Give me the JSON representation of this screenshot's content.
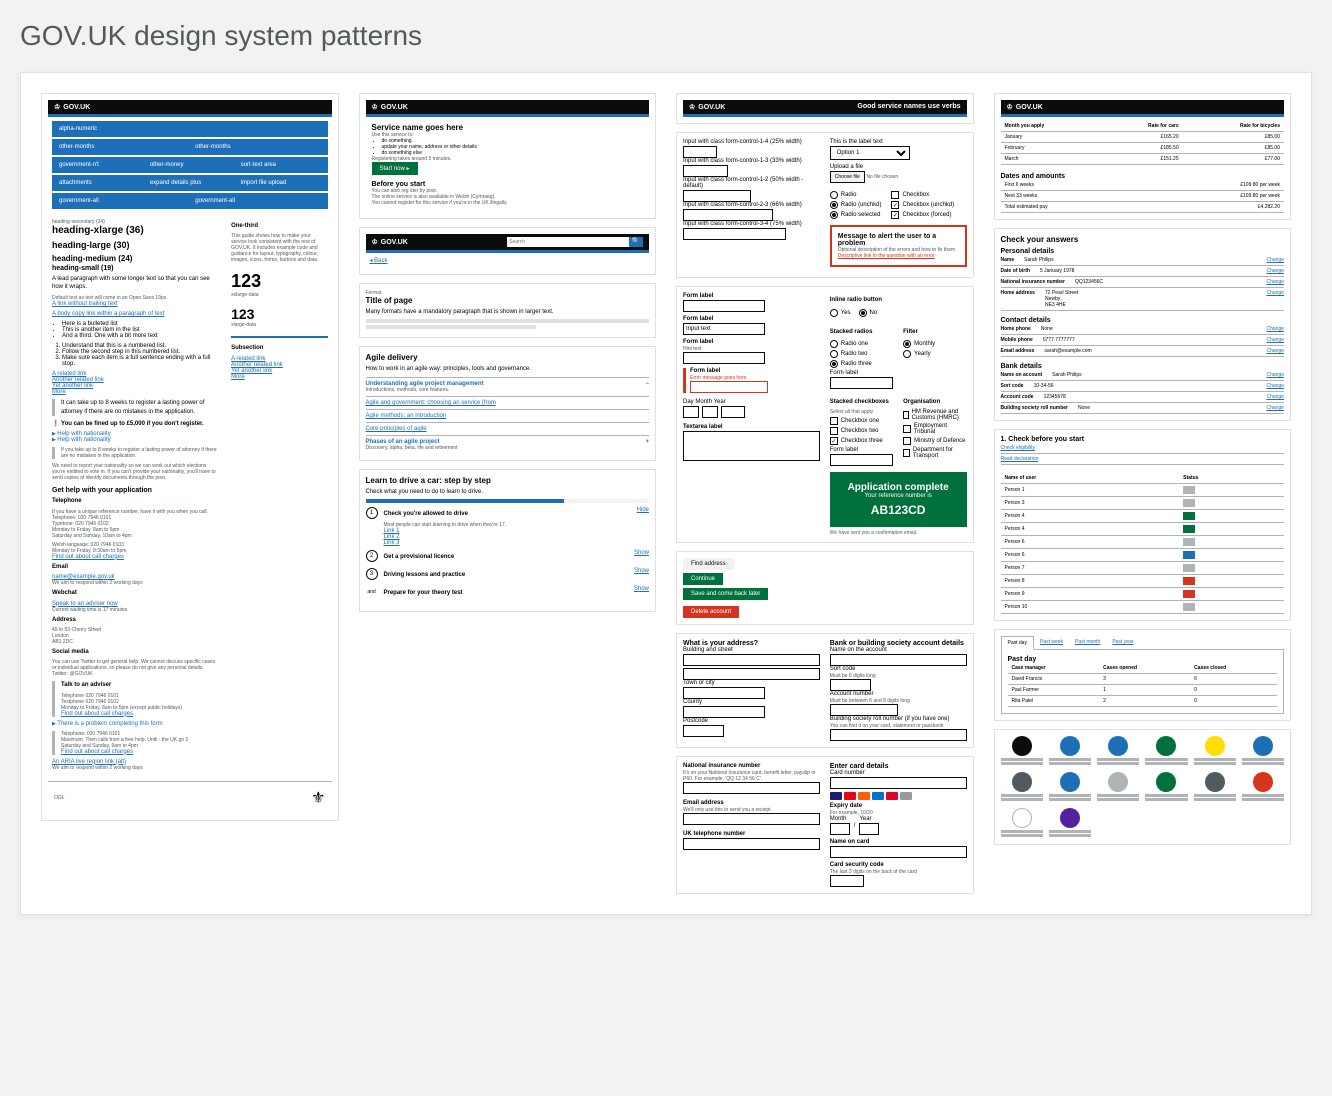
{
  "page_title": "GOV.UK design system patterns",
  "govuk_brand": "GOV.UK",
  "col1": {
    "nav": {
      "row1": [
        "alpha-numeric"
      ],
      "row2": [
        "other-months",
        "other-months"
      ],
      "row3": [
        "government-n't",
        "other-money",
        "sort-text area"
      ],
      "row4": [
        "attachments",
        "expand details plus",
        "import file upload"
      ],
      "row5": [
        "government-all",
        "government-all"
      ]
    },
    "headings": {
      "secondary_caption": "heading-secondary (24)",
      "xl": "heading-xlarge (36)",
      "l": "heading-large (30)",
      "m": "heading-medium (24)",
      "s": "heading-small (19)"
    },
    "lead": "A lead paragraph with some longer text so that you can see how it wraps.",
    "default_text": "Default text as text will come in an Open Sans 19px.",
    "link1": "A link without trailing text",
    "link_in_para": "A body copy link within a paragraph of text",
    "bullets": [
      "Here is a bulleted list",
      "This is another item in the list",
      "And a third. One with a bit more text"
    ],
    "numbered": [
      "Understand that this is a numbered list.",
      "Follow the second step in this numbered list.",
      "Make sure each item is a full sentence ending with a full stop."
    ],
    "related": {
      "title": "A related link",
      "items": [
        "Another related link",
        "Yet another link",
        "More"
      ]
    },
    "inset1": "It can take up to 8 weeks to register a lasting power of attorney if there are no mistakes in the application.",
    "warning": "You can be fined up to £5,000 if you don't register.",
    "details1": "Help with nationality",
    "details2": "Help with nationality",
    "details2_inset": "If you take up to 8 weeks to register a lasting power of attorney if there are no mistakes in the application.",
    "details2_body": "We need to report your nationality so we can work out which elections you're entitled to vote in. If you can't provide your nationality, you'll have to send copies of identity documents through the post.",
    "contact": {
      "heading": "Get help with your application",
      "telephone": "Telephone",
      "telephone_body": "If you have a unique reference number, have it with you when you call.",
      "tel1": "Telephone: 020 7946 0101",
      "tel2": "Typetone: 020 7946 0102",
      "hours1": "Monday to Friday, 8am to 6pm",
      "hours2": "Saturday and Sunday, 10am to 4pm",
      "welsh_heading": "Welsh language: 020 7946 0103",
      "welsh_hours": "Monday to Friday, 8:30am to 5pm",
      "charges_link": "Find out about call charges",
      "email": "Email",
      "email_addr": "name@example.gov.uk",
      "email_note": "We aim to respond within 2 working days",
      "webchat": "Webchat",
      "webchat_link": "Speak to an adviser now",
      "webchat_note": "Current waiting time is 17 minutes",
      "address": "Address",
      "address_lines": [
        "49 to 53 Cherry Street",
        "London",
        "AB1 2DC"
      ],
      "social": "Social media",
      "social_body": "You can use Twitter to get general help. We cannot discuss specific cases or individual applications, so please do not give any personal details.",
      "twitter": "Twitter: @GOVUK"
    },
    "adviser": {
      "heading": "Talk to an adviser",
      "tel": "Telephone 020 7946 0101",
      "textphone": "Textphone 020 7946 0102",
      "hours": "Monday to Friday, 8am to 5pm (except public holidays)",
      "link": "Find out about call charges"
    },
    "problem": {
      "summary": "There is a problem completing this form",
      "items": [
        "Telephone: 020 7946 0101",
        "Maximum. Then calls from a free help. Until - the UK go 2",
        "Saturday and Sunday, 9am to 4pm",
        "Find out about call charges"
      ]
    },
    "aria_link": "An ARIA live region link (alt)",
    "aria_note": "We aim to respond within 2 working days",
    "sidebar": {
      "one_third": "One-third",
      "one_third_body": "This guide shows how to make your service look consistent with the rest of GOV.UK. It includes example code and guidance for layout, typography, colour, images, icons, forms, buttons and data.",
      "big1": "123",
      "big1_label": "xxlarge-data",
      "big2": "123",
      "big2_label": "xlarge-data",
      "subsection": "Subsection",
      "sub_items": [
        "A related link",
        "Another related link",
        "Yet another link",
        "More"
      ]
    },
    "footer_ogl": "OGL"
  },
  "col2": {
    "service_header": "Service name goes here",
    "service_body": "Use this service to:",
    "service_bullets": [
      "do something",
      "update your name, address or other details",
      "do something else"
    ],
    "register_note": "Registering takes around 5 minutes.",
    "start_now": "Start now ▸",
    "before": "Before you start",
    "before_body1": "You can also reg ster by post.",
    "before_body2": "The online service is also available in Welsh (Cymraeg).",
    "before_body3": "You cannot register for this service if you're in the UK illegally.",
    "back_link": "◂ Back",
    "search_placeholder": "Search",
    "format_caption": "Format",
    "page_title": "Title of page",
    "page_body": "Many formats have a mandatory paragraph that is shown in larger text.",
    "agile_title": "Agile delivery",
    "agile_body": "How to work in an agile way: principles, tools and governance.",
    "accordions": [
      {
        "title": "Understanding agile project management",
        "sub": "Introductions, methods, core features."
      },
      {
        "title": "Agile and government: choosing an service (from",
        "sub": ""
      },
      {
        "title": "Agile methods: an introduction",
        "sub": ""
      },
      {
        "title": "Core principles of agile",
        "sub": ""
      },
      {
        "title": "Phases of an agile project",
        "sub": "Discovery, alpha, beta, life and retirement"
      }
    ],
    "steps_title": "Learn to drive a car: step by step",
    "steps_sub": "Check what you need to do to learn to drive.",
    "steps": [
      {
        "n": "1",
        "title": "Check you're allowed to drive",
        "hide": "Hide",
        "body": "Most people can start learning to drive when they're 17.",
        "links": [
          "Link 1",
          "Link 2",
          "Link 3"
        ]
      },
      {
        "n": "2",
        "title": "Get a provisional licence",
        "show": "Show"
      },
      {
        "n": "3",
        "title": "Driving lessons and practice",
        "show": "Show"
      },
      {
        "n": "and",
        "title": "Prepare for your theory test",
        "show": "Show"
      }
    ]
  },
  "col3": {
    "header_service": "Good service names use verbs",
    "widths_heading": "Input width class form-control-1-4 (25% width)",
    "widths": [
      "Input with class form-control-1-4 (25% width)",
      "Input with class form-control-1-3 (33% width)",
      "Input with class form-control-1-2 (50% width - default)",
      "Input with class form-control-2-3 (66% width)",
      "Input with class form-control-3-4 (75% width)"
    ],
    "select_label": "This is the label text",
    "select_value": "Option 1",
    "file_label": "Upload a file",
    "file_btn": "Choose file",
    "file_status": "No file chosen",
    "radio_single": "Radio",
    "checkbox_single": "Checkbox",
    "radio_unchk": "Radio (unchkd)",
    "checkbox_unchkd": "Checkbox (unchkd)",
    "radio_selected": "Radio selected",
    "checkbox_forced": "Checkbox (forced)",
    "error_summary_title": "Message to alert the user to a problem",
    "error_summary_body": "Optional description of the errors and how to fix them",
    "error_summary_link": "Descriptive link to the question with an error",
    "inline_radio_heading": "Inline radio button",
    "yes": "Yes",
    "no": "No",
    "form_label1": "Form label",
    "form_label2": "Form label",
    "input_text": "Input text",
    "form_label3": "Form label",
    "form_label_error": "Form label",
    "error_msg": "Error message goes here",
    "stacked_radios": "Stacked radios",
    "radios": [
      "Radio one",
      "Radio two",
      "Radio three"
    ],
    "radio_form_label": "Form label",
    "filter": "Filter",
    "filter_opts": [
      "Monthly",
      "Yearly"
    ],
    "date_heading": "Day    Month    Year",
    "stacked_checks": "Stacked checkboxes",
    "checks_hint": "Select all that apply",
    "checks": [
      "Checkbox one",
      "Checkbox two",
      "Checkbox three"
    ],
    "check_form_label": "Form label",
    "org_heading": "Organisation",
    "orgs": [
      "HM Revenue and Customs (HMRC)",
      "Employment Tribunal",
      "Ministry of Defence",
      "Department for Transport"
    ],
    "textarea_label": "Textarea label",
    "complete_title": "Application complete",
    "complete_sub": "Your reference number is",
    "complete_ref": "AB123CD",
    "complete_note": "We have sent you a confirmation email.",
    "buttons": {
      "find": "Find address",
      "continue": "Continue",
      "save_later": "Save and come back later",
      "delete": "Delete account"
    },
    "address_q": "What is your address?",
    "addr_building": "Building and street",
    "addr_town": "Town or city",
    "addr_county": "County",
    "addr_postcode": "Postcode",
    "bank_heading": "Bank or building society account details",
    "bank_name": "Name on the account",
    "sort_code": "Sort code",
    "sort_hint": "Must be 6 digits long",
    "acct_num": "Account number",
    "acct_hint": "Must be between 6 and 8 digits long",
    "roll": "Building society roll number (if you have one)",
    "roll_hint": "You can find it on your card, statement or passbook",
    "ni_label": "National insurance number",
    "ni_hint": "It's on your National Insurance card, benefit letter, payslip or P60. For example, 'QQ 12 34 56 C'.",
    "email_label": "Email address",
    "email_hint": "We'll only use this to send you a receipt",
    "uk_tel": "UK telephone number",
    "card_heading": "Enter card details",
    "card_num": "Card number",
    "expiry": "Expiry date",
    "expiry_hint": "For example, 10/20",
    "exp_month": "Month",
    "exp_year": "Year",
    "name_on_card": "Name on card",
    "csc": "Card security code",
    "csc_hint": "The last 3 digits on the back of the card"
  },
  "col4": {
    "rates_table": {
      "headers": [
        "Month you apply",
        "Rate for cars",
        "Rate for bicycles"
      ],
      "rows": [
        [
          "January",
          "£165.20",
          "£85.00"
        ],
        [
          "February",
          "£185.50",
          "£85.00"
        ],
        [
          "March",
          "£151.25",
          "£77.00"
        ]
      ]
    },
    "dates_heading": "Dates and amounts",
    "dates_rows": [
      [
        "First 6 weeks",
        "£109.80 per week"
      ],
      [
        "Next 33 weeks",
        "£109.80 per week"
      ],
      [
        "Total estimated pay",
        "£4,282.20"
      ]
    ],
    "check_heading": "Check your answers",
    "personal": "Personal details",
    "personal_rows": [
      [
        "Name",
        "Sarah Philips"
      ],
      [
        "Date of birth",
        "5 January 1978"
      ],
      [
        "National insurance number",
        "QQ123456C"
      ],
      [
        "Home address",
        "72 Pearl Street\nNewby\nNE3 4HE"
      ]
    ],
    "contact_heading": "Contact details",
    "contact_rows": [
      [
        "Home phone",
        "None"
      ],
      [
        "Mobile phone",
        "0777 7777777"
      ],
      [
        "Email address",
        "sarah@example.com"
      ]
    ],
    "bank_heading": "Bank details",
    "bank_rows": [
      [
        "Name on account",
        "Sarah Philips"
      ],
      [
        "Sort code",
        "10-34-56"
      ],
      [
        "Account code",
        "12345678"
      ],
      [
        "Building society roll number",
        "None"
      ]
    ],
    "change": "Change",
    "task_heading": "1. Check before you start",
    "tasks": [
      "Check eligibility",
      "Read declaration"
    ],
    "progress_table": {
      "name_header": "Name of user",
      "status_header": "Status",
      "rows": [
        "Person 1",
        "Person 3",
        "Person 4",
        "Person 4",
        "Person 6",
        "Person 6",
        "Person 7",
        "Person 8",
        "Person 9",
        "Person 10"
      ]
    },
    "tabs": [
      "Past day",
      "Past week",
      "Past month",
      "Past year"
    ],
    "tab_heading": "Past day",
    "tab_table": {
      "headers": [
        "Case manager",
        "Cases opened",
        "Cases closed"
      ],
      "rows": [
        [
          "David Francis",
          "3",
          "6"
        ],
        [
          "Paul Farmer",
          "1",
          "0"
        ],
        [
          "Rita Patel",
          "2",
          "0"
        ]
      ]
    },
    "colors": {
      "row1": [
        "#0b0c0c",
        "#1d70b8",
        "#1d70b8",
        "#00703c",
        "#ffdd00",
        "#1d70b8"
      ],
      "row2": [
        "#505a5f",
        "#1d70b8",
        "#b1b4b6",
        "#00703c",
        "#505a5f",
        "#d4351c"
      ],
      "row3": [
        "#ffffff",
        "#5521a0"
      ]
    }
  }
}
